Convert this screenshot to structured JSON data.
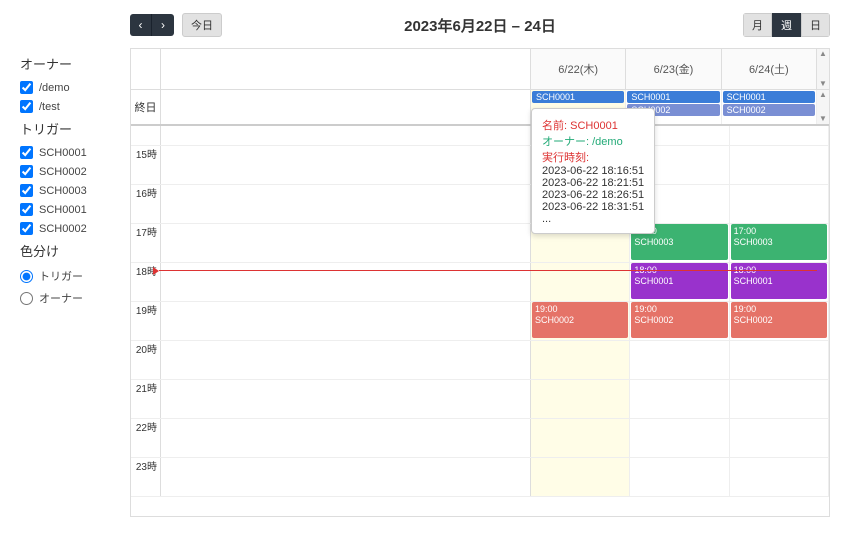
{
  "sidebar": {
    "owner_heading": "オーナー",
    "owners": [
      "/demo",
      "/test"
    ],
    "trigger_heading": "トリガー",
    "triggers": [
      "SCH0001",
      "SCH0002",
      "SCH0003",
      "SCH0001",
      "SCH0002"
    ],
    "coloring_heading": "色分け",
    "color_trigger": "トリガー",
    "color_owner": "オーナー"
  },
  "toolbar": {
    "today_label": "今日",
    "title": "2023年6月22日 – 24日",
    "view_month": "月",
    "view_week": "週",
    "view_day": "日"
  },
  "days": [
    "6/22(木)",
    "6/23(金)",
    "6/24(土)"
  ],
  "allday_label": "終日",
  "allday": {
    "d0": [
      "SCH0001"
    ],
    "d1": [
      "SCH0001",
      "SCH0002"
    ],
    "d2": [
      "SCH0001",
      "SCH0002"
    ]
  },
  "hours": [
    "15時",
    "16時",
    "17時",
    "18時",
    "19時",
    "20時",
    "21時",
    "22時",
    "23時"
  ],
  "events": {
    "d0_19": {
      "time": "19:00",
      "name": "SCH0002",
      "color": "ev-coral"
    },
    "d1_17": {
      "time": "17:00",
      "name": "SCH0003",
      "color": "ev-green"
    },
    "d1_18": {
      "time": "18:00",
      "name": "SCH0001",
      "color": "ev-purple"
    },
    "d1_19": {
      "time": "19:00",
      "name": "SCH0002",
      "color": "ev-coral"
    },
    "d2_17": {
      "time": "17:00",
      "name": "SCH0003",
      "color": "ev-green"
    },
    "d2_18": {
      "time": "18:00",
      "name": "SCH0001",
      "color": "ev-purple"
    },
    "d2_19": {
      "time": "19:00",
      "name": "SCH0002",
      "color": "ev-coral"
    }
  },
  "tooltip": {
    "name_label": "名前: ",
    "name": "SCH0001",
    "owner_label": "オーナー: ",
    "owner": "/demo",
    "exec_label": "実行時刻:",
    "times": [
      "2023-06-22 18:16:51",
      "2023-06-22 18:21:51",
      "2023-06-22 18:26:51",
      "2023-06-22 18:31:51"
    ],
    "more": "..."
  }
}
